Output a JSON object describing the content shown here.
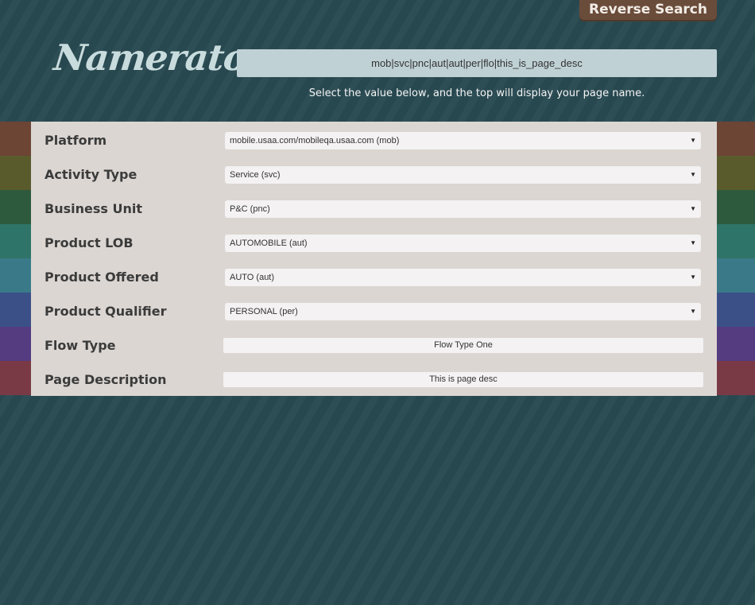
{
  "header": {
    "reverse_search_label": "Reverse Search",
    "logo_text": "Namerator",
    "page_name_output": "mob|svc|pnc|aut|aut|per|flo|this_is_page_desc",
    "instruction": "Select the value below, and the top will display your page name."
  },
  "rows": [
    {
      "label": "Platform",
      "type": "select",
      "value": "mobile.usaa.com/mobileqa.usaa.com (mob)"
    },
    {
      "label": "Activity Type",
      "type": "select",
      "value": "Service (svc)"
    },
    {
      "label": "Business Unit",
      "type": "select",
      "value": "P&C (pnc)"
    },
    {
      "label": "Product LOB",
      "type": "select",
      "value": "AUTOMOBILE (aut)"
    },
    {
      "label": "Product Offered",
      "type": "select",
      "value": "AUTO (aut)"
    },
    {
      "label": "Product Qualifier",
      "type": "select",
      "value": "PERSONAL (per)"
    },
    {
      "label": "Flow Type",
      "type": "input",
      "value": "Flow Type One"
    },
    {
      "label": "Page Description",
      "type": "input",
      "value": "This is page desc"
    }
  ],
  "stripe_colors": [
    "#6d4534",
    "#5a5b2c",
    "#2d5a3c",
    "#2e7468",
    "#3a7a88",
    "#3b5087",
    "#553b80",
    "#7a3a45"
  ],
  "caret_glyph": "▼"
}
